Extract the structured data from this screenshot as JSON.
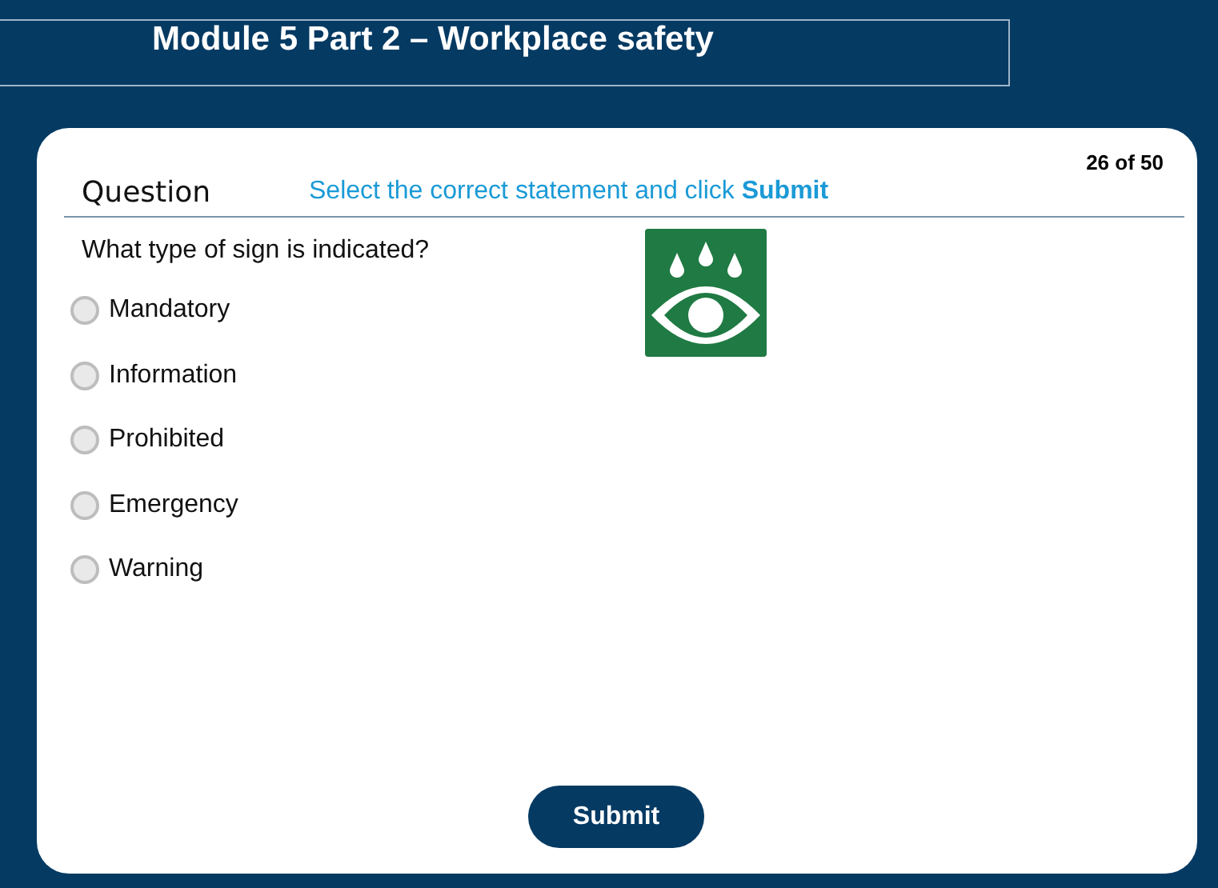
{
  "title": "Module 5 Part 2 – Workplace safety",
  "question_label": "Question",
  "instruction": "Select the correct statement and click **Submit**",
  "counter": "26 of 50",
  "question": "What type of sign is indicated?",
  "options": [
    {
      "label": "Mandatory",
      "selected": false
    },
    {
      "label": "Information",
      "selected": false
    },
    {
      "label": "Prohibited",
      "selected": false
    },
    {
      "label": "Emergency",
      "selected": false
    },
    {
      "label": "Warning",
      "selected": false
    }
  ],
  "button": "Submit"
}
